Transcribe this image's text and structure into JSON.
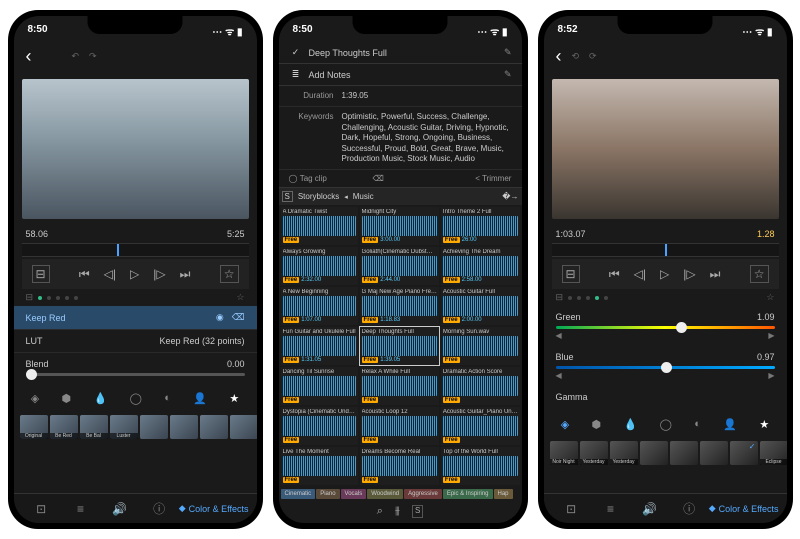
{
  "p1": {
    "time": "8:50",
    "pos": "58.06",
    "total": "5:25",
    "effect_row": "Keep Red",
    "lut_label": "LUT",
    "lut_value": "Keep Red (32 points)",
    "blend_label": "Blend",
    "blend_value": "0.00",
    "thumbs": [
      "Original",
      "Be Red",
      "Be Bal",
      "Luster",
      "",
      "",
      "",
      ""
    ],
    "bottom_label": "Color & Effects"
  },
  "p2": {
    "time": "8:50",
    "title": "Deep Thoughts Full",
    "notes": "Add Notes",
    "duration_k": "Duration",
    "duration_v": "1:39.05",
    "keywords_k": "Keywords",
    "keywords_v": "Optimistic, Powerful, Success, Challenge, Challenging, Acoustic Guitar, Driving, Hypnotic, Dark, Hopeful, Strong, Ongoing, Business, Successful, Proud, Bold, Great, Brave, Music, Production Music, Stock Music, Audio",
    "tag": "Tag clip",
    "trimmer": "< Trimmer",
    "library": "Storyblocks",
    "lib_sub": "Music",
    "clips": [
      {
        "n": "A Dramatic Twist",
        "d": ""
      },
      {
        "n": "Midnight City",
        "d": "3:00.00"
      },
      {
        "n": "Intro Theme 2 Full",
        "d": "26:00"
      },
      {
        "n": "Always Growing",
        "d": "2:32.00"
      },
      {
        "n": "Goliath(Cinematic Dubst…",
        "d": "2:44.00"
      },
      {
        "n": "Achieving The Dream",
        "d": "2:58.00"
      },
      {
        "n": "A New Beginning",
        "d": "1:07.00"
      },
      {
        "n": "G Maj New Age Piano Fre…",
        "d": "1:18.83"
      },
      {
        "n": "Acoustic Guitar Full",
        "d": "2:00.00"
      },
      {
        "n": "Fun Guitar and Ukulele Full",
        "d": "1:31.05"
      },
      {
        "n": "Deep Thoughts Full",
        "d": "1:39.05",
        "sel": true
      },
      {
        "n": "Morning Sun.wav",
        "d": ""
      },
      {
        "n": "Dancing Til Sunrise",
        "d": ""
      },
      {
        "n": "Relax A While Full",
        "d": ""
      },
      {
        "n": "Dramatic Action Score",
        "d": ""
      },
      {
        "n": "Dystopia (Cinematic Und…",
        "d": ""
      },
      {
        "n": "Acoustic Loop 12",
        "d": ""
      },
      {
        "n": "Acoustic Guitar_Piano Un…",
        "d": ""
      },
      {
        "n": "Live The Moment",
        "d": ""
      },
      {
        "n": "Dreams Become Real",
        "d": ""
      },
      {
        "n": "Top of the World Full",
        "d": ""
      }
    ],
    "free": "Free",
    "cats": [
      "Cinematic",
      "Piano",
      "Vocals",
      "Woodwind",
      "Aggressive",
      "Epic & Inspiring",
      "Hap"
    ]
  },
  "p3": {
    "time": "8:52",
    "pos": "1:03.07",
    "total": "1.28",
    "green_l": "Green",
    "green_v": "1.09",
    "blue_l": "Blue",
    "blue_v": "0.97",
    "gamma_l": "Gamma",
    "thumbs": [
      "Noir Night",
      "Yesterday",
      "Yesterday",
      "",
      "",
      "",
      "",
      "Eclipse"
    ],
    "bottom_label": "Color & Effects"
  },
  "icons": {
    "back": "‹",
    "undo": "↶",
    "redo": "↷",
    "pencil": "✎",
    "tag": "◯",
    "trash": "🗑",
    "skip_b": "⏮",
    "step_b": "◁|",
    "play": "▷",
    "step_f": "|▷",
    "skip_f": "⏭",
    "star": "☆",
    "fx": "⊟",
    "search": "⌕",
    "filter": "⚙",
    "diamond": "◆",
    "cube": "⬢",
    "drop": "◆",
    "mask": "⬤",
    "person": "⬤",
    "crop": "⊡",
    "stack": "≡",
    "speaker": "🔊",
    "info": "ⓘ",
    "signal": "▮▮▮",
    "wifi": "⋮"
  }
}
